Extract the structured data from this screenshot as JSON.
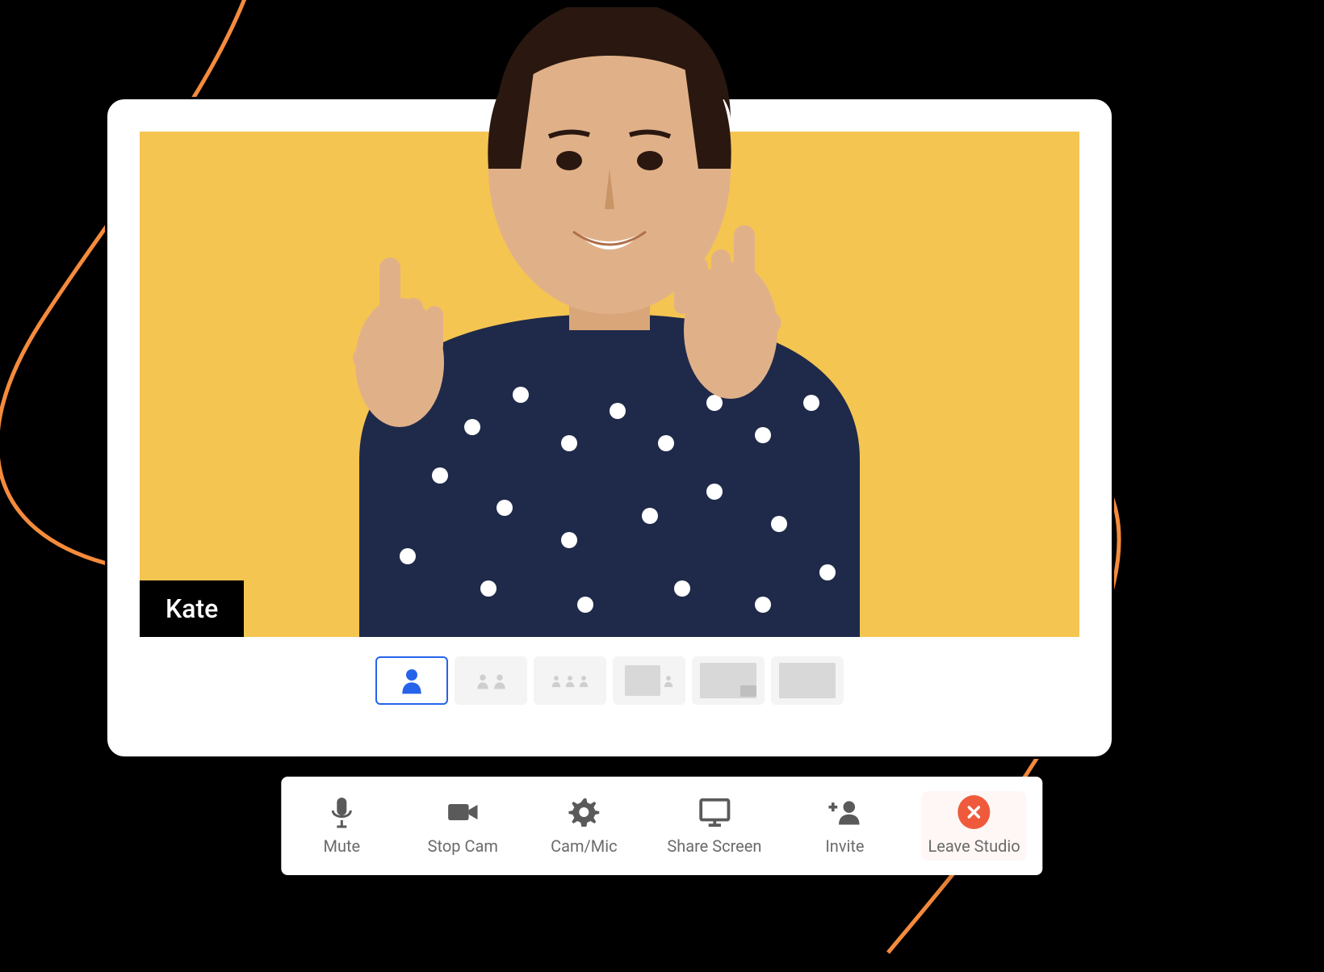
{
  "colors": {
    "accent": "#2563eb",
    "video_bg": "#f5c552",
    "danger": "#ef5a3c",
    "decorative_line": "#f58b3c"
  },
  "video": {
    "presenter_name": "Kate"
  },
  "layouts": {
    "selected_index": 0,
    "options": [
      {
        "name": "single",
        "active": true
      },
      {
        "name": "two-up",
        "active": false
      },
      {
        "name": "three-up",
        "active": false
      },
      {
        "name": "screen-with-speaker",
        "active": false
      },
      {
        "name": "screen-pip",
        "active": false
      },
      {
        "name": "screen-only",
        "active": false
      }
    ]
  },
  "toolbar": {
    "mute": {
      "label": "Mute",
      "icon": "microphone-icon"
    },
    "stop_cam": {
      "label": "Stop Cam",
      "icon": "video-camera-icon"
    },
    "cam_mic": {
      "label": "Cam/Mic",
      "icon": "gear-icon"
    },
    "share_screen": {
      "label": "Share Screen",
      "icon": "monitor-icon"
    },
    "invite": {
      "label": "Invite",
      "icon": "invite-user-icon"
    },
    "leave": {
      "label": "Leave Studio",
      "icon": "close-icon"
    }
  }
}
